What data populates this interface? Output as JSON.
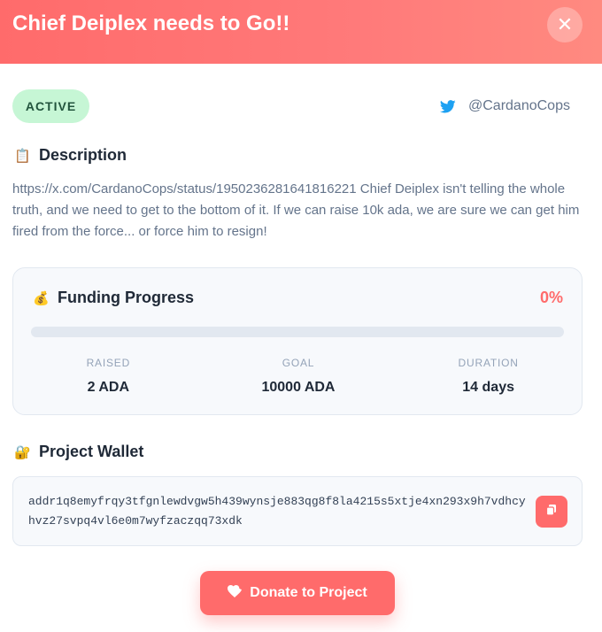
{
  "modal": {
    "title": "Chief Deiplex needs to Go!!",
    "close_label": "✕"
  },
  "status": {
    "label": "ACTIVE",
    "color": "#c6f6d5"
  },
  "social": {
    "icon": "twitter-icon",
    "handle": "@CardanoCops"
  },
  "description": {
    "icon": "clipboard-icon",
    "emoji": "📋",
    "heading": "Description",
    "text": "https://x.com/CardanoCops/status/1950236281641816221 Chief Deiplex isn't telling the whole truth, and we need to get to the bottom of it. If we can raise 10k ada, we are sure we can get him fired from the force... or force him to resign!"
  },
  "funding": {
    "icon": "money-bag-icon",
    "emoji": "💰",
    "heading": "Funding Progress",
    "percent_label": "0%",
    "progress_fraction": 0.0,
    "stats": [
      {
        "label": "RAISED",
        "value": "2 ADA"
      },
      {
        "label": "GOAL",
        "value": "10000 ADA"
      },
      {
        "label": "DURATION",
        "value": "14 days"
      }
    ]
  },
  "wallet": {
    "icon": "lock-icon",
    "emoji": "🔐",
    "heading": "Project Wallet",
    "address": "addr1q8emyfrqy3tfgnlewdvgw5h439wynsje883qg8f8la4215s5xtje4xn293x9h7vdhcyhvz27svpq4vl6e0m7wyfzaczqq73xdk",
    "copy_icon": "copy-icon"
  },
  "donate": {
    "icon": "heart-icon",
    "label": "Donate to Project"
  },
  "colors": {
    "accent": "#ff6b6b",
    "twitter": "#1da1f2",
    "muted_text": "#64748b"
  }
}
